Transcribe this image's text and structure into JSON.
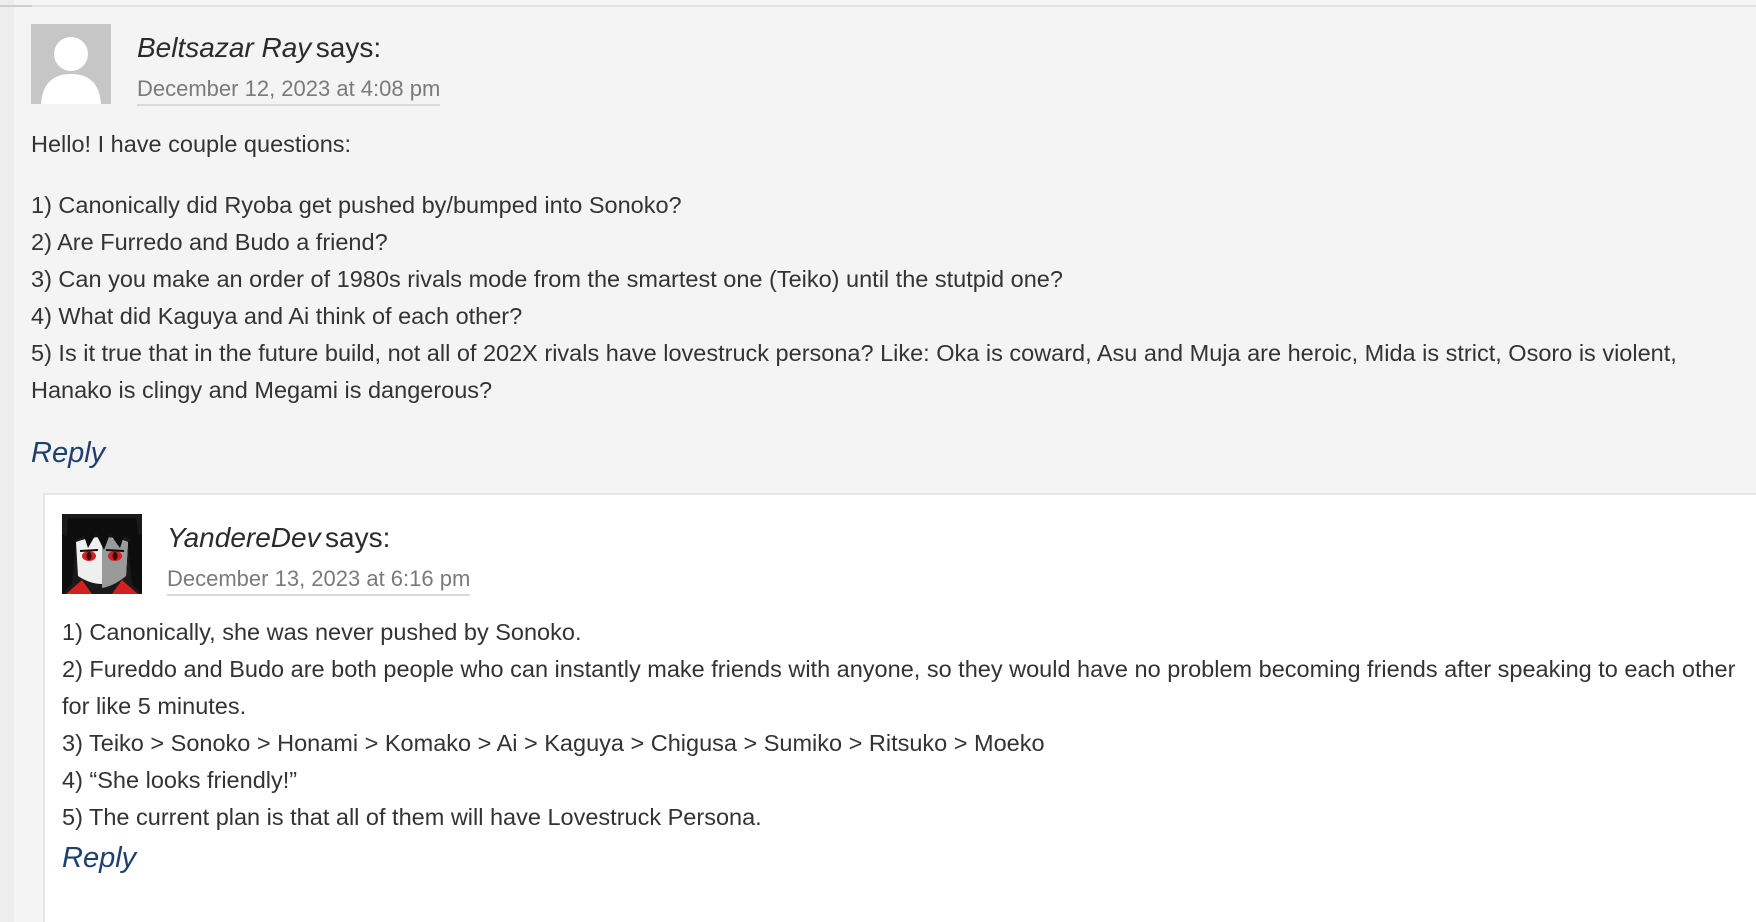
{
  "comments": [
    {
      "author": "Beltsazar Ray",
      "says": "says:",
      "date": "December 12, 2023 at 4:08 pm",
      "avatar": "default-user-silhouette",
      "lines": [
        "Hello! I have couple questions:",
        "1) Canonically did Ryoba get pushed by/bumped into Sonoko?",
        "2) Are Furredo and Budo a friend?",
        "3) Can you make an order of 1980s rivals mode from the smartest one (Teiko) until the stutpid one?",
        "4) What did Kaguya and Ai think of each other?",
        "5) Is it true that in the future build, not all of 202X rivals have lovestruck persona? Like: Oka is coward, Asu and Muja are heroic, Mida is strict, Osoro is violent, Hanako is clingy and Megami is dangerous?"
      ],
      "reply_label": "Reply"
    },
    {
      "author": "YandereDev",
      "says": "says:",
      "date": "December 13, 2023 at 6:16 pm",
      "avatar": "anime-character-portrait",
      "lines": [
        "1) Canonically, she was never pushed by Sonoko.",
        "2) Fureddo and Budo are both people who can instantly make friends with anyone, so they would have no problem becoming friends after speaking to each other for like 5 minutes.",
        "3) Teiko > Sonoko > Honami > Komako > Ai > Kaguya > Chigusa > Sumiko > Ritsuko > Moeko",
        "4) “She looks friendly!”",
        "5) The current plan is that all of them will have Lovestruck Persona."
      ],
      "reply_label": "Reply"
    }
  ],
  "colors": {
    "page_background": "#f4f4f4",
    "reply_background": "#ffffff",
    "text": "#333333",
    "date_text": "#7a7a7a",
    "reply_link": "#1f3f6e",
    "avatar_placeholder": "#c6c6c6",
    "avatar_eye": "#d42020"
  }
}
